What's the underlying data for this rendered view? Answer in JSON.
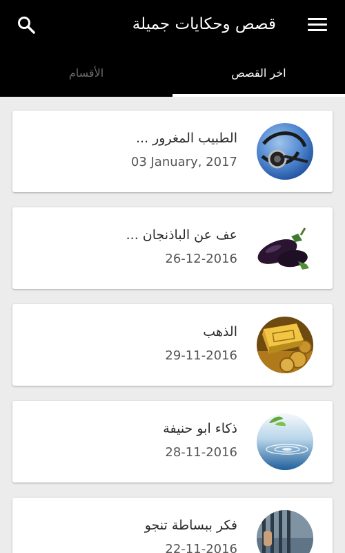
{
  "app": {
    "title": "قصص وحكايات جميلة"
  },
  "toolbar": {
    "menu_icon": "menu-icon",
    "search_icon": "search-icon"
  },
  "tabs": [
    {
      "label": "اخر القصص",
      "active": true
    },
    {
      "label": "الأقسام",
      "active": false
    }
  ],
  "stories": [
    {
      "title": "الطبيب المغرور ...",
      "date": "03 January, 2017",
      "image": "stethoscope"
    },
    {
      "title": "عف عن الباذنجان ...",
      "date": "26-12-2016",
      "image": "eggplant"
    },
    {
      "title": "الذهب",
      "date": "29-11-2016",
      "image": "gold"
    },
    {
      "title": "ذكاء ابو حنيفة",
      "date": "28-11-2016",
      "image": "water-drop"
    },
    {
      "title": "فكر ببساطة تنجو",
      "date": "22-11-2016",
      "image": "prison-bars"
    }
  ],
  "colors": {
    "appbar": "#000000",
    "background": "#ececec",
    "card": "#ffffff",
    "inactive_tab": "#6d6d6d"
  }
}
